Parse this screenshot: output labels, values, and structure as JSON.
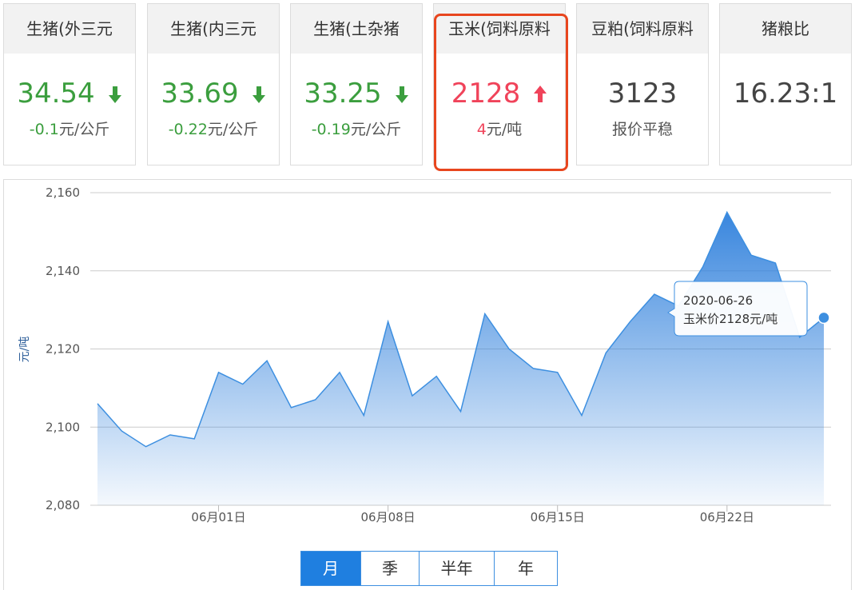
{
  "cards": [
    {
      "title": "生猪(外三元",
      "price": "34.54",
      "change": "-0.1",
      "unit": "元/公斤",
      "trend": "down"
    },
    {
      "title": "生猪(内三元",
      "price": "33.69",
      "change": "-0.22",
      "unit": "元/公斤",
      "trend": "down"
    },
    {
      "title": "生猪(土杂猪",
      "price": "33.25",
      "change": "-0.19",
      "unit": "元/公斤",
      "trend": "down"
    },
    {
      "title": "玉米(饲料原料",
      "price": "2128",
      "change": "4",
      "unit": "元/吨",
      "trend": "up"
    },
    {
      "title": "豆粕(饲料原料",
      "price": "3123",
      "change": "",
      "unit": "报价平稳",
      "trend": "flat"
    },
    {
      "title": "猪粮比",
      "price": "16.23:1",
      "change": "",
      "unit": "",
      "trend": "none"
    }
  ],
  "colors": {
    "down": "#3b9e3e",
    "up": "#f0435a",
    "series": "#3d8fe0",
    "highlight": "#e8461e"
  },
  "tooltip": {
    "date": "2020-06-26",
    "text": "玉米价2128元/吨"
  },
  "tabs": [
    "月",
    "季",
    "半年",
    "年"
  ],
  "active_tab": "月",
  "chart_data": {
    "type": "area",
    "ylabel": "元/吨",
    "ylim": [
      2080,
      2160
    ],
    "yticks": [
      2080,
      2100,
      2120,
      2140,
      2160
    ],
    "ytick_labels": [
      "2,080",
      "2,100",
      "2,120",
      "2,140",
      "2,160"
    ],
    "xtick_labels": [
      "06月01日",
      "06月08日",
      "06月15日",
      "06月22日"
    ],
    "xtick_dates": [
      "2020-06-01",
      "2020-06-08",
      "2020-06-15",
      "2020-06-22"
    ],
    "x": [
      "2020-05-27",
      "2020-05-28",
      "2020-05-29",
      "2020-05-30",
      "2020-05-31",
      "2020-06-01",
      "2020-06-02",
      "2020-06-03",
      "2020-06-04",
      "2020-06-05",
      "2020-06-06",
      "2020-06-07",
      "2020-06-08",
      "2020-06-09",
      "2020-06-10",
      "2020-06-11",
      "2020-06-12",
      "2020-06-13",
      "2020-06-14",
      "2020-06-15",
      "2020-06-16",
      "2020-06-17",
      "2020-06-18",
      "2020-06-19",
      "2020-06-20",
      "2020-06-21",
      "2020-06-22",
      "2020-06-23",
      "2020-06-24",
      "2020-06-25",
      "2020-06-26"
    ],
    "values": [
      2106,
      2099,
      2095,
      2098,
      2097,
      2114,
      2111,
      2117,
      2105,
      2107,
      2114,
      2103,
      2127,
      2108,
      2113,
      2104,
      2129,
      2120,
      2115,
      2114,
      2103,
      2119,
      2127,
      2134,
      2131,
      2141,
      2155,
      2144,
      2142,
      2123,
      2128
    ],
    "grid": true
  }
}
